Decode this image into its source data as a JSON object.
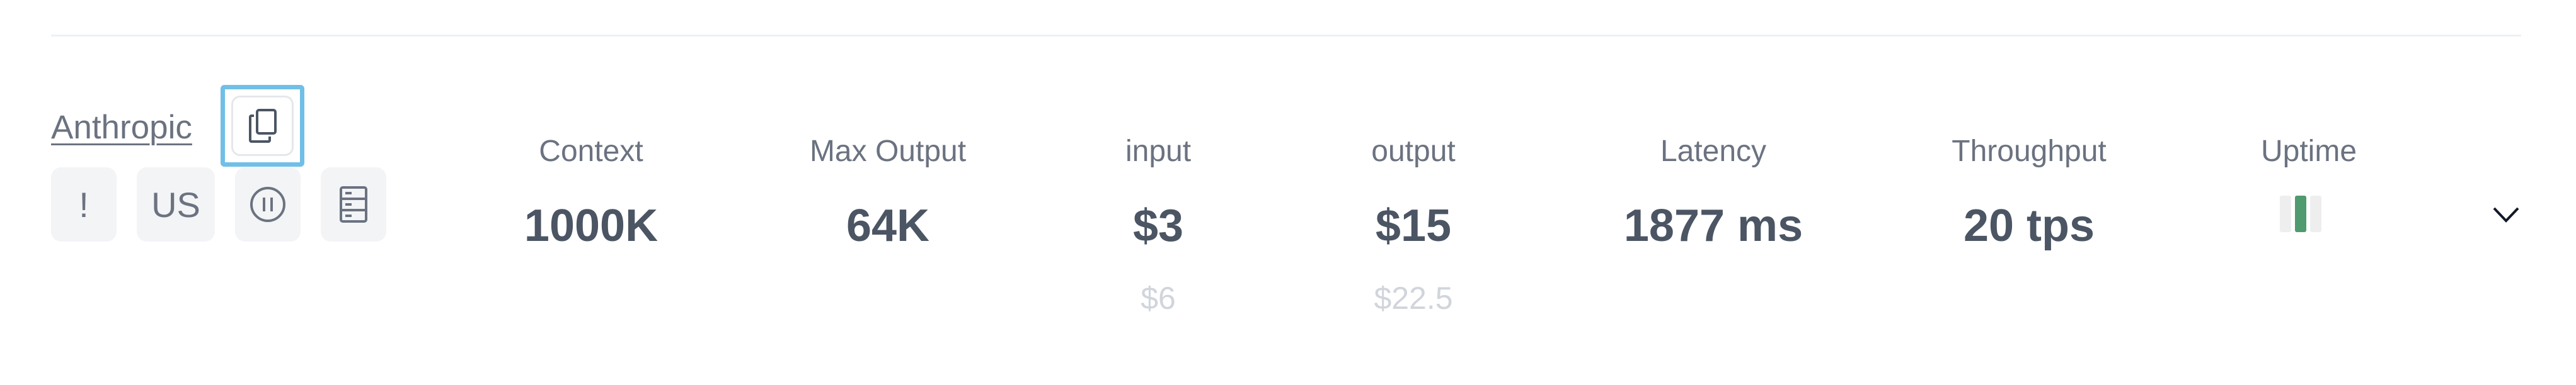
{
  "provider": {
    "name": "Anthropic"
  },
  "badges": [
    {
      "label": "!",
      "icon": "warning-icon"
    },
    {
      "label": "US",
      "icon": "region-label"
    },
    {
      "label": "",
      "icon": "pause-circle-icon"
    },
    {
      "label": "",
      "icon": "server-icon"
    }
  ],
  "columns": {
    "context": {
      "label": "Context",
      "value": "1000K"
    },
    "max_output": {
      "label": "Max Output",
      "value": "64K"
    },
    "input": {
      "label": "input",
      "value": "$3",
      "sub": "$6"
    },
    "output": {
      "label": "output",
      "value": "$15",
      "sub": "$22.5"
    },
    "latency": {
      "label": "Latency",
      "value": "1877 ms"
    },
    "throughput": {
      "label": "Throughput",
      "value": "20 tps"
    },
    "uptime": {
      "label": "Uptime",
      "bars": [
        "none",
        "up",
        "none"
      ]
    }
  },
  "colors": {
    "focus_ring": "#6fbfe7",
    "uptime_up": "#4f9a6e",
    "uptime_none": "#eeeeef"
  }
}
